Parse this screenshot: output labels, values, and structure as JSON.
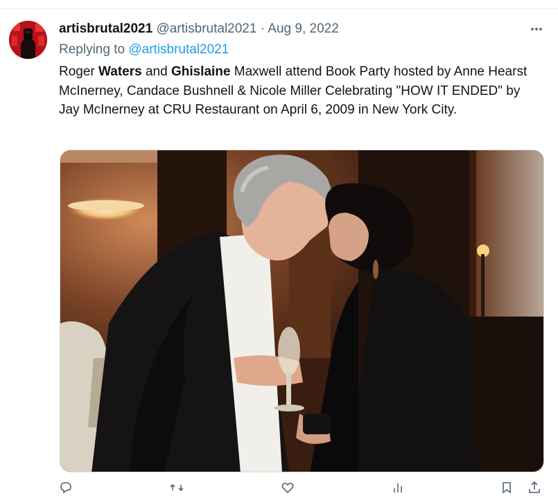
{
  "tweet": {
    "display_name": "artisbrutal2021",
    "handle": "@artisbrutal2021",
    "separator": "·",
    "date": "Aug 9, 2022",
    "replying_prefix": "Replying to",
    "replying_handle": "@artisbrutal2021",
    "text_parts": [
      "Roger ",
      "Waters",
      " and ",
      "Ghislaine",
      " Maxwell attend Book Party hosted by Anne Hearst McInerney, Candace Bushnell & Nicole Miller Celebrating \"HOW IT ENDED\" by Jay McInerney at CRU Restaurant on April 6, 2009 in New York City."
    ]
  },
  "icons": {
    "more": "more-horizontal-icon",
    "reply": "reply-icon",
    "retweet": "retweet-icon",
    "like": "like-icon",
    "views": "views-icon",
    "bookmark": "bookmark-icon",
    "share": "share-icon"
  },
  "colors": {
    "link": "#1d9bf0",
    "secondary_text": "#536471",
    "primary_text": "#0f1419",
    "avatar_red": "#c8161a"
  }
}
